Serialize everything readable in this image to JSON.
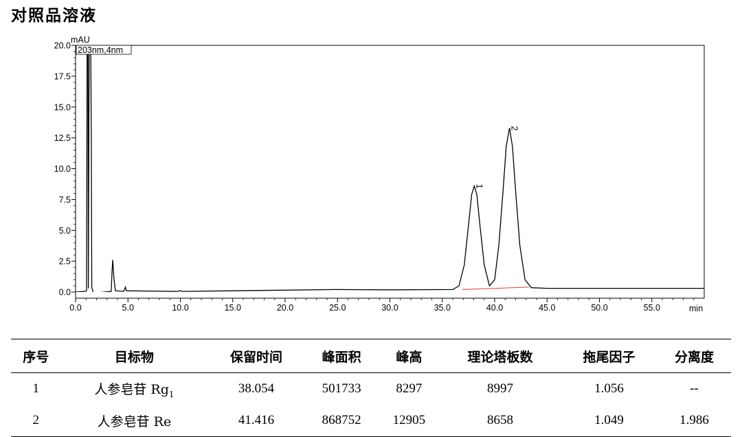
{
  "title": "对照品溶液",
  "chart_data": {
    "type": "line",
    "y_unit_label": "mAU",
    "x_unit_label": "min",
    "legend": "203nm,4nm",
    "xlim": [
      0,
      60
    ],
    "ylim": [
      0,
      20
    ],
    "x_ticks": [
      0,
      5,
      10,
      15,
      20,
      25,
      30,
      35,
      40,
      45,
      50,
      55
    ],
    "x_tick_labels": [
      "0.0",
      "5.0",
      "10.0",
      "15.0",
      "20.0",
      "25.0",
      "30.0",
      "35.0",
      "40.0",
      "45.0",
      "50.0",
      "55.0"
    ],
    "y_ticks": [
      0,
      2.5,
      5,
      7.5,
      10,
      12.5,
      15,
      17.5,
      20
    ],
    "y_tick_labels": [
      "0.0",
      "2.5",
      "5.0",
      "7.5",
      "10.0",
      "12.5",
      "15.0",
      "17.5",
      "20.0"
    ],
    "trace": [
      [
        0,
        0
      ],
      [
        0.8,
        0.05
      ],
      [
        1.05,
        0.1
      ],
      [
        1.1,
        20
      ],
      [
        1.18,
        20
      ],
      [
        1.22,
        0.3
      ],
      [
        1.3,
        20
      ],
      [
        1.45,
        20
      ],
      [
        1.5,
        12.2
      ],
      [
        1.55,
        0.4
      ],
      [
        1.7,
        -0.1
      ],
      [
        3.0,
        0.02
      ],
      [
        3.4,
        0.05
      ],
      [
        3.5,
        2.0
      ],
      [
        3.55,
        2.6
      ],
      [
        3.65,
        1.2
      ],
      [
        3.8,
        0.1
      ],
      [
        4.6,
        0.05
      ],
      [
        4.75,
        0.4
      ],
      [
        4.85,
        0.1
      ],
      [
        7.0,
        0.08
      ],
      [
        9.8,
        0.05
      ],
      [
        10.0,
        0.12
      ],
      [
        10.2,
        0.05
      ],
      [
        15,
        0.1
      ],
      [
        24.8,
        0.2
      ],
      [
        30,
        0.18
      ],
      [
        36,
        0.2
      ],
      [
        36.6,
        0.5
      ],
      [
        37.1,
        2.2
      ],
      [
        37.5,
        5.4
      ],
      [
        37.8,
        7.9
      ],
      [
        38.054,
        8.6
      ],
      [
        38.3,
        7.9
      ],
      [
        38.6,
        5.4
      ],
      [
        39.0,
        2.2
      ],
      [
        39.5,
        0.5
      ],
      [
        40.0,
        1.0
      ],
      [
        40.4,
        3.8
      ],
      [
        40.8,
        8.2
      ],
      [
        41.1,
        11.8
      ],
      [
        41.416,
        13.3
      ],
      [
        41.7,
        11.8
      ],
      [
        42.0,
        8.2
      ],
      [
        42.4,
        3.8
      ],
      [
        42.9,
        1.0
      ],
      [
        43.5,
        0.35
      ],
      [
        45,
        0.3
      ],
      [
        50,
        0.3
      ],
      [
        60,
        0.3
      ]
    ],
    "baselines": [
      {
        "x": [
          36.9,
          43.3
        ],
        "y": [
          0.2,
          0.4
        ]
      }
    ],
    "peaks": [
      {
        "label": "1",
        "x": 38.054,
        "y": 8.6
      },
      {
        "label": "2",
        "x": 41.416,
        "y": 13.3
      }
    ]
  },
  "table": {
    "headers": [
      "序号",
      "目标物",
      "保留时间",
      "峰面积",
      "峰高",
      "理论塔板数",
      "拖尾因子",
      "分离度"
    ],
    "rows": [
      {
        "no": "1",
        "name": "人参皂苷 Rg",
        "sub": "1",
        "rt": "38.054",
        "area": "501733",
        "height": "8297",
        "plates": "8997",
        "tailing": "1.056",
        "resolution": "--"
      },
      {
        "no": "2",
        "name": "人参皂苷 Re",
        "sub": "",
        "rt": "41.416",
        "area": "868752",
        "height": "12905",
        "plates": "8658",
        "tailing": "1.049",
        "resolution": "1.986"
      }
    ]
  }
}
